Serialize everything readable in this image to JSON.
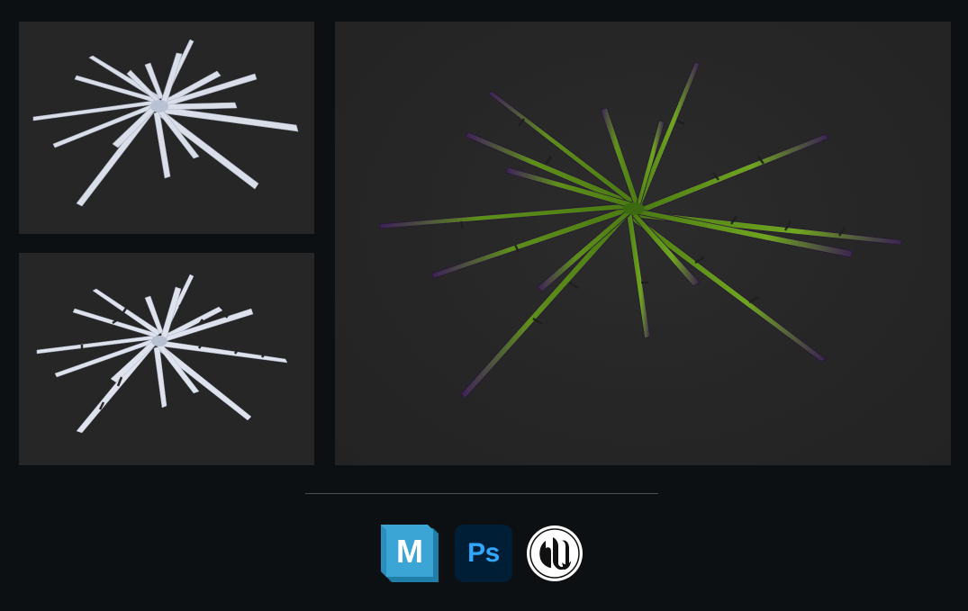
{
  "panels": [
    {
      "name": "plant-base-mesh-view",
      "description_shown": false
    },
    {
      "name": "plant-cut-mesh-view",
      "description_shown": false
    },
    {
      "name": "plant-textured-render-view",
      "description_shown": false
    }
  ],
  "tools": [
    {
      "icon": "maya-icon",
      "label": "M",
      "color": "#38a9d8"
    },
    {
      "icon": "photoshop-icon",
      "label": "Ps",
      "color": "#31a8ff",
      "background": "#001e36"
    },
    {
      "icon": "unreal-engine-icon",
      "label": "",
      "color": "#ffffff"
    }
  ],
  "colors": {
    "page_background": "#0c1013",
    "panel_background": "#262626",
    "mesh_white": "#dfe4ee",
    "leaf_green": "#6a9a1e",
    "leaf_purple": "#4a2a5a"
  }
}
